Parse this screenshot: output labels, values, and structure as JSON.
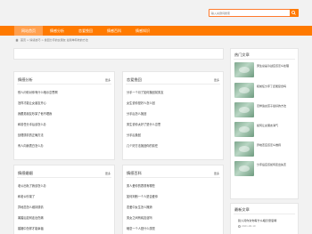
{
  "search": {
    "placeholder": "输入关键词搜索"
  },
  "nav": {
    "items": [
      {
        "label": "网站首页",
        "active": true
      },
      {
        "label": "情感分析",
        "active": false
      },
      {
        "label": "恋爱挽回",
        "active": false
      },
      {
        "label": "情感百科",
        "active": false
      },
      {
        "label": "情感知识",
        "active": false
      },
      {
        "label": "情感分析",
        "active": false
      }
    ]
  },
  "breadcrumb": {
    "text": "首页 > 情感技巧 > 挽回分手的女朋友 最简单有效的方法"
  },
  "cards": [
    {
      "title": "情感分析",
      "more": "更多",
      "items": [
        "别人问你对你有什么暗示意思啊",
        "怎样才能让女朋友开心",
        "我跟男朋友吵架了他不理我",
        "和前任分手后该怎么办",
        "处理感情的正确方法",
        "有人向我表白怎么办"
      ]
    },
    {
      "title": "恋爱挽回",
      "more": "更多",
      "items": [
        "分手一个月了如何挽回前男友",
        "女生说你是好人怎么回",
        "分手后怎么挽回",
        "男生说你太好了是什么意思",
        "分手后挽回",
        "几个好方法挽回你的前任"
      ]
    },
    {
      "title": "情感婚姻",
      "more": "更多",
      "items": [
        "老公出轨了我该怎么办",
        "和老公吵架了",
        "异地恋怎么维持感情",
        "离婚后如何走出伤痛",
        "婚姻中怎样才能幸福"
      ]
    },
    {
      "title": "情感百科",
      "more": "更多",
      "items": [
        "男人爱你的表现有哪些",
        "如何判断一个人是否爱你",
        "恋爱中女生怎么撒娇",
        "男女之间有纯友谊吗",
        "暗恋一个人是什么感觉"
      ]
    }
  ],
  "hot": {
    "title": "热门文章",
    "items": [
      "男生总是冷战应该怎么处理",
      "和前任分手了还能复合吗",
      "怎样追女孩子最好的方法",
      "如何让女朋友消气",
      "异地恋应该怎么维持",
      "分手后应该如何走出失恋"
    ]
  },
  "recent": {
    "title": "最新文章",
    "items": [
      {
        "title": "别人问你对你有什么暗示意思啊",
        "date": "2021-06-19"
      }
    ]
  }
}
